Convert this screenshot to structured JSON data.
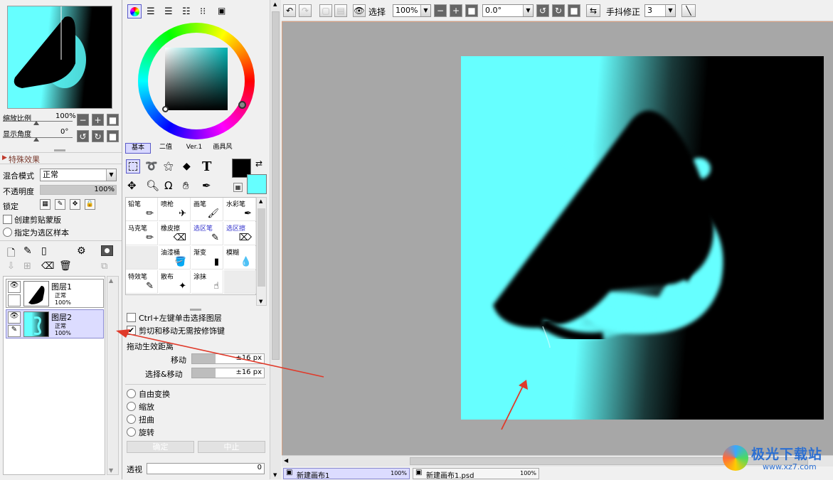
{
  "navigator": {
    "zoom_label": "缩放比例",
    "zoom_value": "100%",
    "angle_label": "显示角度",
    "angle_value": "0°"
  },
  "effects": {
    "header": "特殊效果"
  },
  "layer_props": {
    "blend_label": "混合模式",
    "blend_value": "正常",
    "opacity_label": "不透明度",
    "opacity_value": "100%",
    "opacity_level": 1.0,
    "lock_label": "锁定",
    "clip_label": "创建剪贴蒙版",
    "selection_source_label": "指定为选区样本"
  },
  "layers": [
    {
      "name": "图层1",
      "mode": "正常",
      "opacity": "100%"
    },
    {
      "name": "图层2",
      "mode": "正常",
      "opacity": "100%"
    }
  ],
  "color_tabs": [
    "基本",
    "二值",
    "Ver.1",
    "画具风"
  ],
  "colors": {
    "primary": "#000000",
    "secondary": "#66ffff",
    "accent_cyan": "#66ffff",
    "arrow_red": "#e03a2a"
  },
  "brushes": [
    [
      "铅笔",
      "喷枪",
      "画笔",
      "水彩笔"
    ],
    [
      "马克笔",
      "橡皮擦",
      "选区笔",
      "选区擦"
    ],
    [
      "",
      "油漆桶",
      "渐变",
      "模糊"
    ],
    [
      "特效笔",
      "散布",
      "涂抹",
      ""
    ]
  ],
  "options": {
    "ctrl_select_label": "Ctrl+左键单击选择图层",
    "cut_move_label": "剪切和移动无需按修饰键",
    "drag_distance_label": "拖动生效距离",
    "move_label": "移动",
    "move_value": "±16 px",
    "select_move_label": "选择&移动",
    "select_move_value": "±16 px",
    "free_transform": "自由变换",
    "scale": "缩放",
    "distort": "扭曲",
    "rotate": "旋转",
    "ok_label": "确定",
    "cancel_label": "中止",
    "perspective_label": "透视",
    "perspective_value": "0"
  },
  "toolbar": {
    "select_label": "选择",
    "zoom_value": "100%",
    "angle_value": "0.0°",
    "stabilizer_label": "手抖修正",
    "stabilizer_value": "3"
  },
  "tabs": [
    {
      "name": "新建画布1",
      "zoom": "100%"
    },
    {
      "name": "新建画布1.psd",
      "zoom": "100%"
    }
  ],
  "watermark": {
    "brand": "极光下载站",
    "url": "www.xz7.com"
  }
}
